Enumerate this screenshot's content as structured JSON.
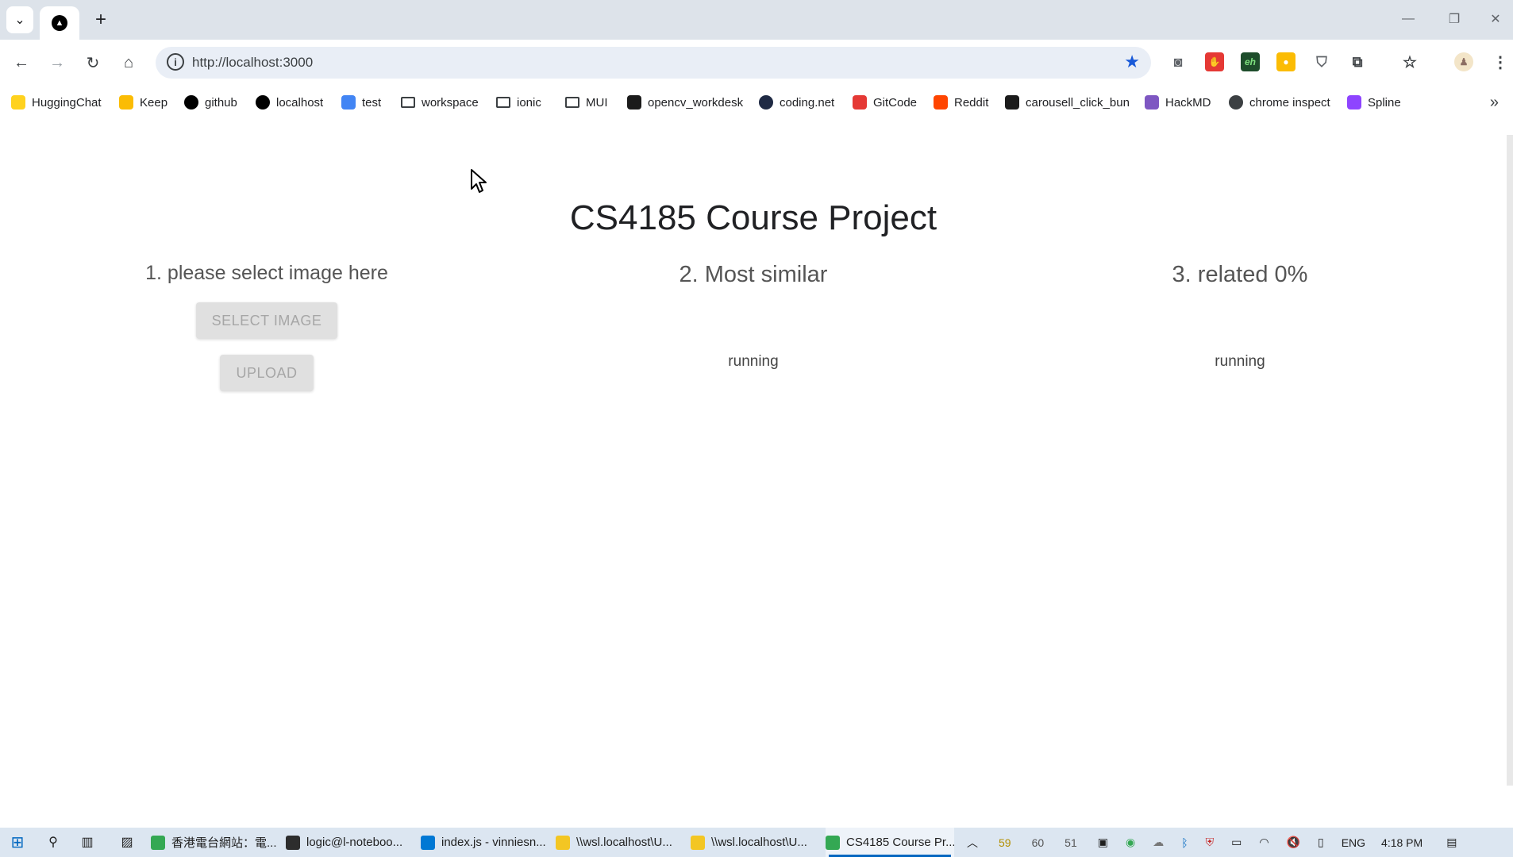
{
  "browser": {
    "url": "http://localhost:3000",
    "tab_favicon": "▲",
    "bookmarks": [
      {
        "label": "HuggingChat",
        "icon": "huggingface-icon",
        "color": "#ffd21e"
      },
      {
        "label": "Keep",
        "icon": "keep-icon",
        "color": "#fbbc04"
      },
      {
        "label": "github",
        "icon": "github-icon",
        "color": "#000000"
      },
      {
        "label": "localhost",
        "icon": "triangle-icon",
        "color": "#000000"
      },
      {
        "label": "test",
        "icon": "target-icon",
        "color": "#4285f4"
      },
      {
        "label": "workspace",
        "icon": "folder-icon",
        "color": ""
      },
      {
        "label": "ionic",
        "icon": "folder-icon",
        "color": ""
      },
      {
        "label": "MUI",
        "icon": "folder-icon",
        "color": ""
      },
      {
        "label": "opencv_workdesk",
        "icon": "vnc-icon",
        "color": "#1b1b1b"
      },
      {
        "label": "coding.net",
        "icon": "coding-icon",
        "color": "#1f2a44"
      },
      {
        "label": "GitCode",
        "icon": "gitcode-icon",
        "color": "#e53935"
      },
      {
        "label": "Reddit",
        "icon": "reddit-icon",
        "color": "#ff4500"
      },
      {
        "label": "carousell_click_bun",
        "icon": "vnc-icon",
        "color": "#1b1b1b"
      },
      {
        "label": "HackMD",
        "icon": "hackmd-icon",
        "color": "#7e57c2"
      },
      {
        "label": "chrome inspect",
        "icon": "globe-icon",
        "color": "#3c4043"
      },
      {
        "label": "Spline",
        "icon": "spline-icon",
        "color": "#8e44ff"
      }
    ]
  },
  "page": {
    "title": "CS4185 Course Project",
    "col1_heading": "1. please select image here",
    "select_button": "SELECT IMAGE",
    "upload_button": "UPLOAD",
    "col2_heading": "2. Most similar",
    "col2_status": "running",
    "col3_heading": "3. related 0%",
    "col3_status": "running"
  },
  "taskbar": {
    "apps": [
      {
        "label": "香港電台網站：電...",
        "color": "#34a853",
        "active": false
      },
      {
        "label": "logic@l-noteboo...",
        "color": "#2d2d2d",
        "active": false
      },
      {
        "label": "index.js - vinniesn...",
        "color": "#0078d4",
        "active": false
      },
      {
        "label": "\\\\wsl.localhost\\U...",
        "color": "#f3c623",
        "active": false
      },
      {
        "label": "\\\\wsl.localhost\\U...",
        "color": "#f3c623",
        "active": false
      },
      {
        "label": "CS4185 Course Pr...",
        "color": "#34a853",
        "active": true
      }
    ],
    "tray_numbers": [
      "59",
      "60",
      "51"
    ],
    "language": "ENG",
    "time": "4:18 PM"
  }
}
